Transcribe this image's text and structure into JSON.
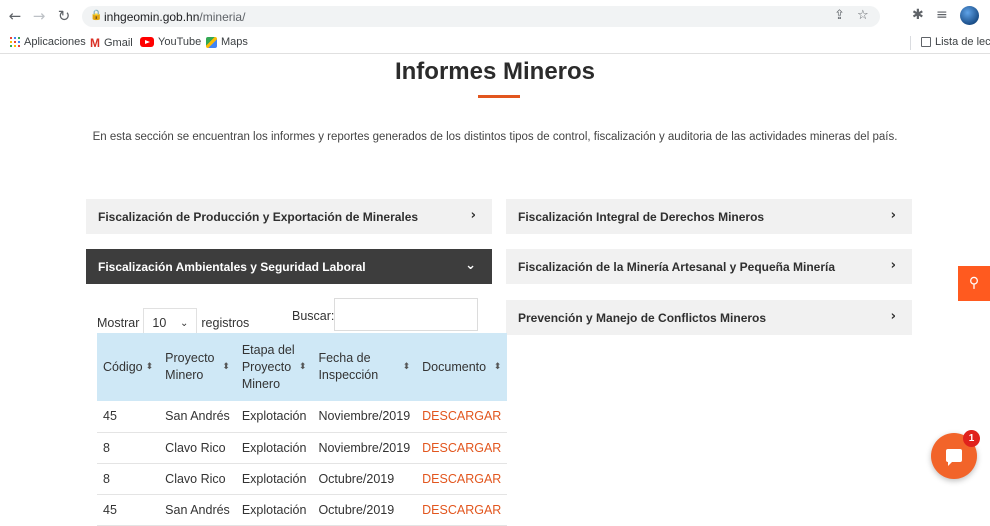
{
  "browser": {
    "url_host": "inhgeomin.gob.hn",
    "url_path": "/mineria/",
    "bookmarks": [
      {
        "label": "Aplicaciones",
        "icon": "apps-grid-icon"
      },
      {
        "label": "Gmail",
        "icon": "gmail-icon"
      },
      {
        "label": "YouTube",
        "icon": "youtube-icon"
      },
      {
        "label": "Maps",
        "icon": "maps-icon"
      }
    ],
    "reading_list": "Lista de lectu"
  },
  "page": {
    "title": "Informes Mineros",
    "intro": "En esta sección se encuentran los informes y reportes generados de los distintos tipos de control, fiscalización y auditoria de las actividades mineras del país.",
    "accent_color": "#e2561e"
  },
  "accordions": {
    "left": [
      {
        "label": "Fiscalización de Producción y Exportación de Minerales",
        "expanded": false
      },
      {
        "label": "Fiscalización Ambientales y Seguridad Laboral",
        "expanded": true
      }
    ],
    "right": [
      {
        "label": "Fiscalización Integral de Derechos Mineros",
        "expanded": false
      },
      {
        "label": "Fiscalización de la Minería Artesanal y Pequeña Minería",
        "expanded": false
      },
      {
        "label": "Prevención y Manejo de Conflictos Mineros",
        "expanded": false
      }
    ]
  },
  "datatable": {
    "show_label": "Mostrar",
    "length_value": "10",
    "records_label": "registros",
    "search_label": "Buscar:",
    "search_value": "",
    "columns": [
      "Código",
      "Proyecto Minero",
      "Etapa del Proyecto Minero",
      "Fecha de Inspección",
      "Documento"
    ],
    "rows": [
      {
        "codigo": "45",
        "proyecto": "San Andrés",
        "etapa": "Explotación",
        "fecha": "Noviembre/2019",
        "documento": "DESCARGAR"
      },
      {
        "codigo": "8",
        "proyecto": "Clavo Rico",
        "etapa": "Explotación",
        "fecha": "Noviembre/2019",
        "documento": "DESCARGAR"
      },
      {
        "codigo": "8",
        "proyecto": "Clavo Rico",
        "etapa": "Explotación",
        "fecha": "Octubre/2019",
        "documento": "DESCARGAR"
      },
      {
        "codigo": "45",
        "proyecto": "San Andrés",
        "etapa": "Explotación",
        "fecha": "Octubre/2019",
        "documento": "DESCARGAR"
      }
    ]
  },
  "chat": {
    "badge_count": "1"
  }
}
